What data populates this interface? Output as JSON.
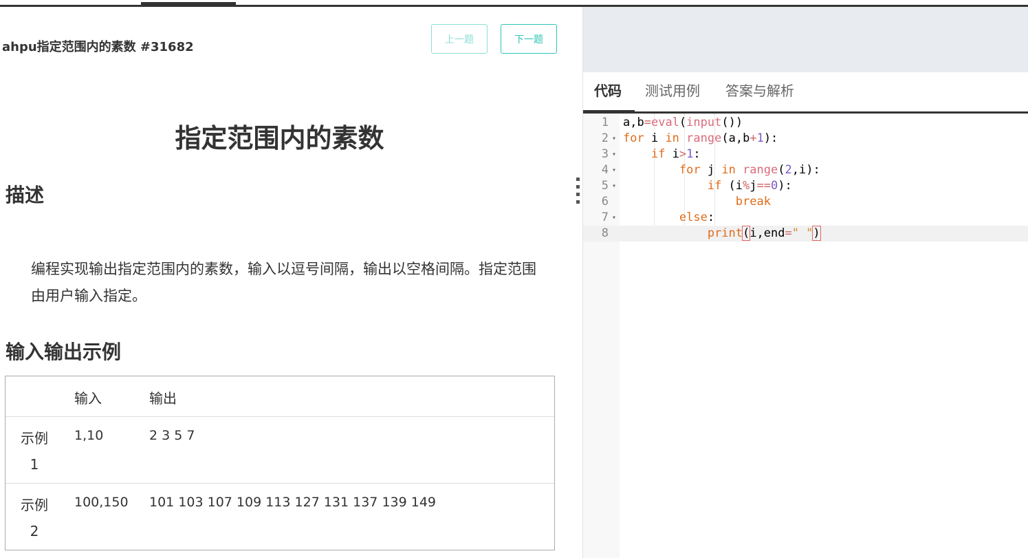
{
  "problem": {
    "title": "ahpu指定范围内的素数 #31682",
    "prev_label": "上一题",
    "next_label": "下一题",
    "heading": "指定范围内的素数",
    "description_heading": "描述",
    "description": "编程实现输出指定范围内的素数，输入以逗号间隔，输出以空格间隔。指定范围由用户输入指定。",
    "examples_heading": "输入输出示例",
    "table": {
      "headers": [
        "",
        "输入",
        "输出"
      ],
      "rows": [
        {
          "label": "示例 1",
          "input": "1,10",
          "output": "2 3 5 7"
        },
        {
          "label": "示例 2",
          "input": "100,150",
          "output": "101 103 107 109 113 127 131 137 139 149"
        }
      ]
    }
  },
  "editor": {
    "tabs": [
      "代码",
      "测试用例",
      "答案与解析"
    ],
    "active_tab": "代码",
    "line_numbers": [
      "1",
      "2",
      "3",
      "4",
      "5",
      "6",
      "7",
      "8"
    ],
    "current_line": 8,
    "code": [
      "a,b=eval(input())",
      "for i in range(a,b+1):",
      "    if i>1:",
      "        for j in range(2,i):",
      "            if (i%j==0):",
      "                break",
      "        else:",
      "            print(i,end=\" \")"
    ]
  },
  "colors": {
    "accent": "#2ec4b6",
    "keyword": "#e06c1a",
    "builtin": "#d96b7a",
    "number": "#7a5ac6",
    "string": "#d28b2a"
  }
}
